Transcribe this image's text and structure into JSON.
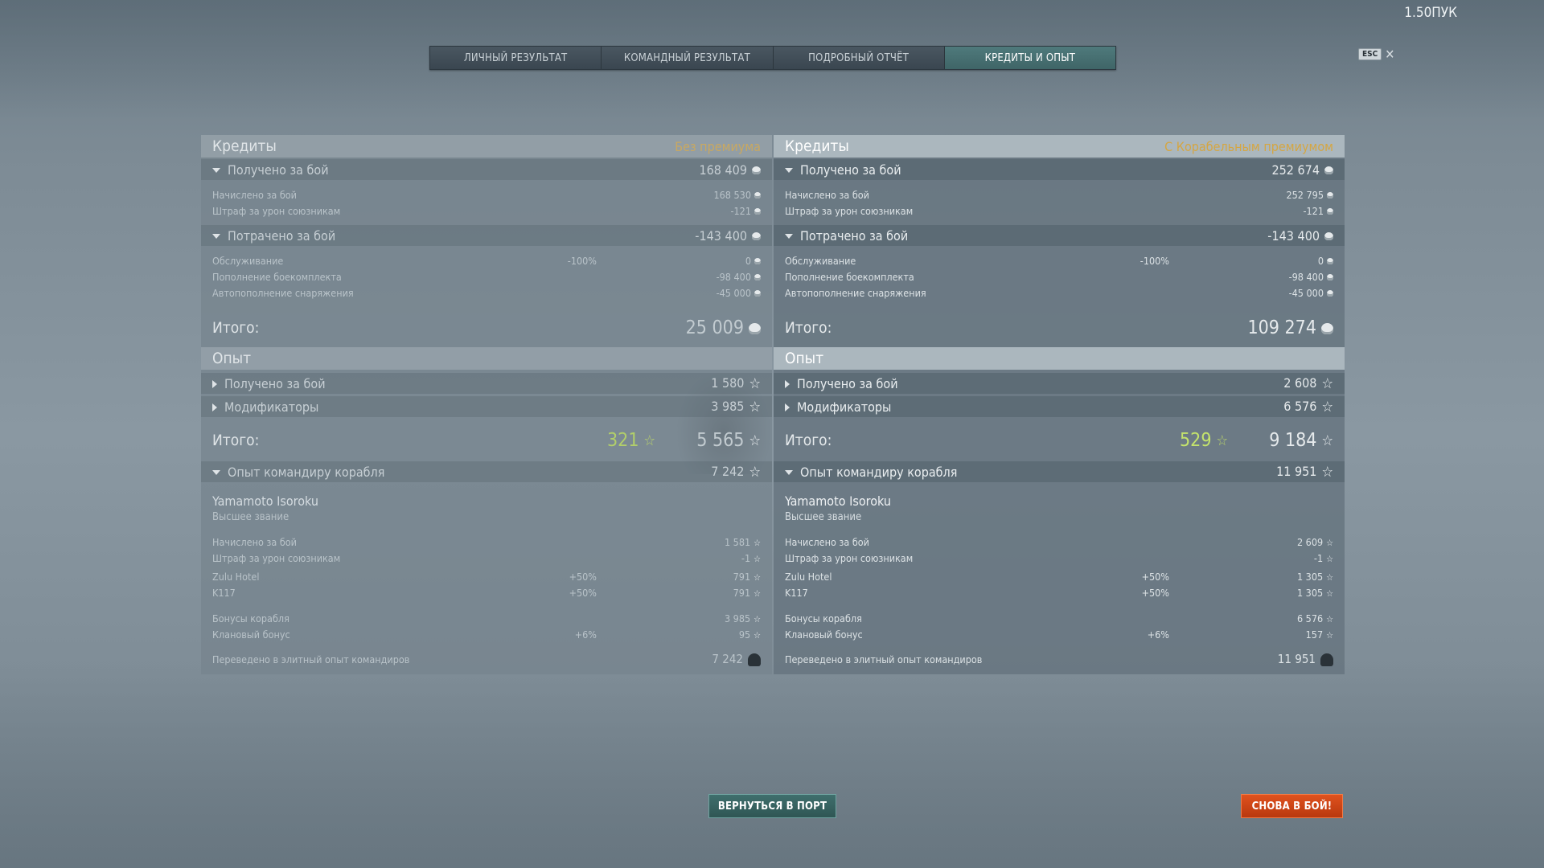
{
  "version": "1.50ПУК",
  "tabs": [
    {
      "label": "ЛИЧНЫЙ РЕЗУЛЬТАТ",
      "active": false
    },
    {
      "label": "КОМАНДНЫЙ РЕЗУЛЬТАТ",
      "active": false
    },
    {
      "label": "ПОДРОБНЫЙ ОТЧЁТ",
      "active": false
    },
    {
      "label": "КРЕДИТЫ И ОПЫТ",
      "active": true
    }
  ],
  "esc": {
    "key": "ESC",
    "close": "✕"
  },
  "left": {
    "credits": {
      "title": "Кредиты",
      "mode": "Без премиума",
      "earned": {
        "label": "Получено за бой",
        "value": "168 409"
      },
      "earned_items": [
        {
          "label": "Начислено за бой",
          "value": "168 530"
        },
        {
          "label": "Штраф за урон союзникам",
          "value": "-121"
        }
      ],
      "spent": {
        "label": "Потрачено за бой",
        "value": "-143 400"
      },
      "spent_items": [
        {
          "label": "Обслуживание",
          "mod": "-100%",
          "value": "0"
        },
        {
          "label": "Пополнение боекомплекта",
          "mod": "",
          "value": "-98 400"
        },
        {
          "label": "Автопополнение снаряжения",
          "mod": "",
          "value": "-45 000"
        }
      ],
      "total": {
        "label": "Итого:",
        "value": "25 009"
      }
    },
    "xp": {
      "title": "Опыт",
      "earned": {
        "label": "Получено за бой",
        "value": "1 580"
      },
      "modifiers": {
        "label": "Модификаторы",
        "value": "3 985"
      },
      "total": {
        "label": "Итого:",
        "free": "321",
        "value": "5 565"
      },
      "commander": {
        "label": "Опыт командиру корабля",
        "value": "7 242"
      },
      "cmdr_name": "Yamamoto Isoroku",
      "cmdr_rank": "Высшее звание",
      "items": [
        {
          "label": "Начислено за бой",
          "mod": "",
          "value": "1 581"
        },
        {
          "label": "Штраф за урон союзникам",
          "mod": "",
          "value": "-1"
        },
        {
          "label": "Zulu Hotel",
          "mod": "+50%",
          "value": "791"
        },
        {
          "label": "K117",
          "mod": "+50%",
          "value": "791"
        },
        {
          "label": "Бонусы корабля",
          "mod": "",
          "value": "3 985"
        },
        {
          "label": "Клановый бонус",
          "mod": "+6%",
          "value": "95"
        }
      ],
      "elite": {
        "label": "Переведено в элитный опыт командиров",
        "value": "7 242"
      }
    }
  },
  "right": {
    "credits": {
      "title": "Кредиты",
      "mode": "С Корабельным премиумом",
      "earned": {
        "label": "Получено за бой",
        "value": "252 674"
      },
      "earned_items": [
        {
          "label": "Начислено за бой",
          "value": "252 795"
        },
        {
          "label": "Штраф за урон союзникам",
          "value": "-121"
        }
      ],
      "spent": {
        "label": "Потрачено за бой",
        "value": "-143 400"
      },
      "spent_items": [
        {
          "label": "Обслуживание",
          "mod": "-100%",
          "value": "0"
        },
        {
          "label": "Пополнение боекомплекта",
          "mod": "",
          "value": "-98 400"
        },
        {
          "label": "Автопополнение снаряжения",
          "mod": "",
          "value": "-45 000"
        }
      ],
      "total": {
        "label": "Итого:",
        "value": "109 274"
      }
    },
    "xp": {
      "title": "Опыт",
      "earned": {
        "label": "Получено за бой",
        "value": "2 608"
      },
      "modifiers": {
        "label": "Модификаторы",
        "value": "6 576"
      },
      "total": {
        "label": "Итого:",
        "free": "529",
        "value": "9 184"
      },
      "commander": {
        "label": "Опыт командиру корабля",
        "value": "11 951"
      },
      "cmdr_name": "Yamamoto Isoroku",
      "cmdr_rank": "Высшее звание",
      "items": [
        {
          "label": "Начислено за бой",
          "mod": "",
          "value": "2 609"
        },
        {
          "label": "Штраф за урон союзникам",
          "mod": "",
          "value": "-1"
        },
        {
          "label": "Zulu Hotel",
          "mod": "+50%",
          "value": "1 305"
        },
        {
          "label": "K117",
          "mod": "+50%",
          "value": "1 305"
        },
        {
          "label": "Бонусы корабля",
          "mod": "",
          "value": "6 576"
        },
        {
          "label": "Клановый бонус",
          "mod": "+6%",
          "value": "157"
        }
      ],
      "elite": {
        "label": "Переведено в элитный опыт командиров",
        "value": "11 951"
      }
    }
  },
  "buttons": {
    "port": "ВЕРНУТЬСЯ В ПОРТ",
    "battle": "СНОВА В БОЙ!"
  },
  "colors": {
    "active_tab": "#4f7a7c",
    "premium_label": "#d5a642",
    "free_xp": "#b9d36b",
    "battle_button": "#d8481a",
    "port_button": "#3a6866"
  }
}
